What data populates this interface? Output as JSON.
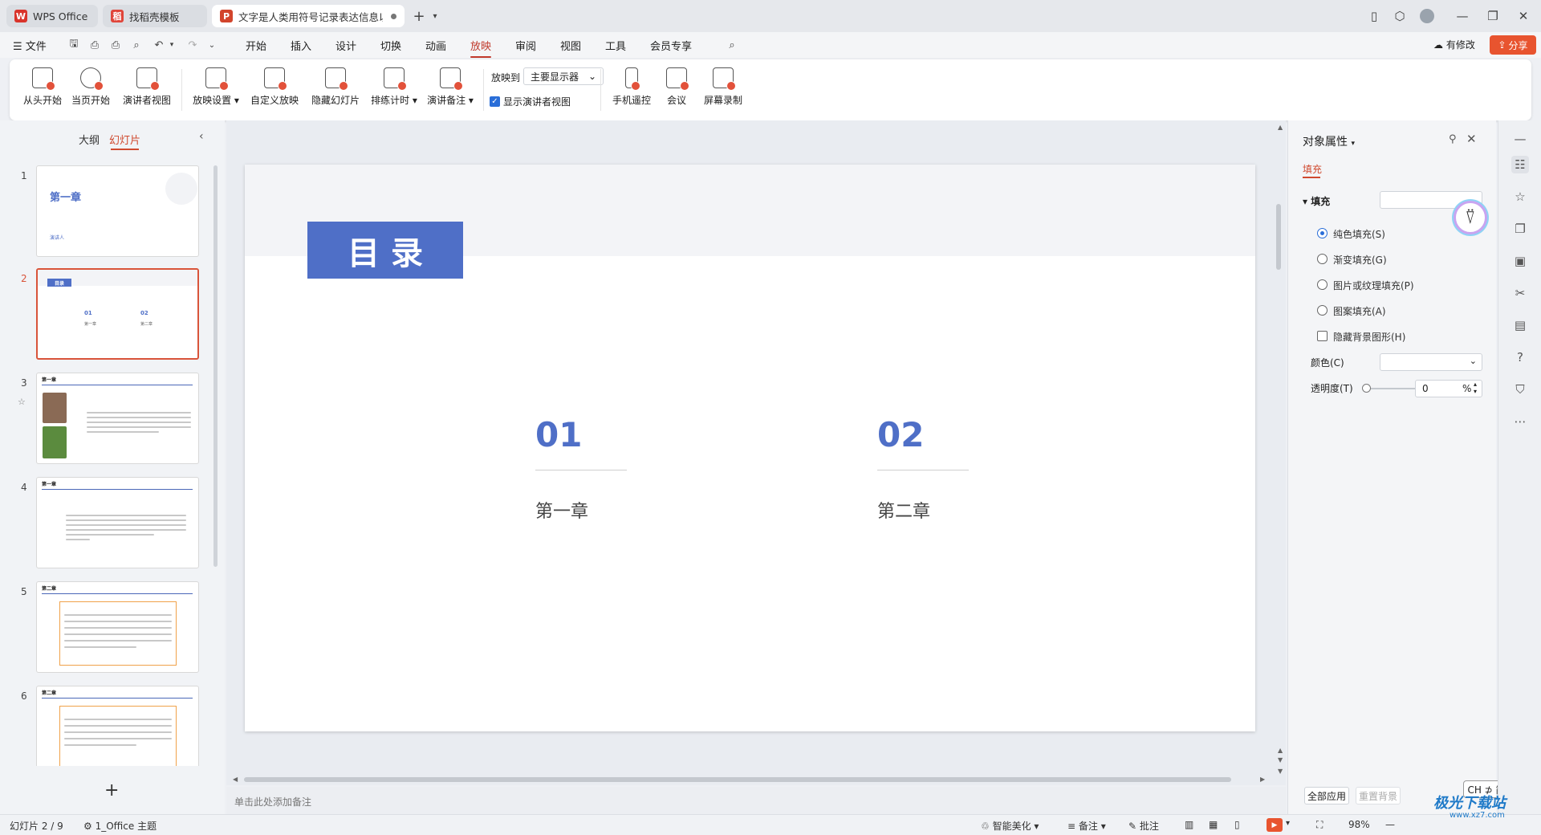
{
  "tabs": [
    {
      "label": "WPS Office"
    },
    {
      "label": "找稻壳模板"
    },
    {
      "label": "文字是人类用符号记录表达信息以"
    }
  ],
  "menu": {
    "file": "文件",
    "items": [
      "开始",
      "插入",
      "设计",
      "切换",
      "动画",
      "放映",
      "审阅",
      "视图",
      "工具",
      "会员专享"
    ],
    "active": "放映",
    "modify": "有修改",
    "share": "分享"
  },
  "ribbon": {
    "from_start": "从头开始",
    "from_current": "当页开始",
    "presenter_view": "演讲者视图",
    "slideshow_settings": "放映设置",
    "custom_show": "自定义放映",
    "hide_slide": "隐藏幻灯片",
    "rehearse": "排练计时",
    "speaker_notes": "演讲备注",
    "play_to_label": "放映到",
    "play_to_value": "主要显示器",
    "show_presenter_view": "显示演讲者视图",
    "phone_remote": "手机遥控",
    "meeting": "会议",
    "screen_record": "屏幕录制"
  },
  "left_panel": {
    "tab_outline": "大纲",
    "tab_slides": "幻灯片",
    "thumbs": [
      {
        "num": "1",
        "title": "第一章",
        "sub": "演讲人"
      },
      {
        "num": "2",
        "title": "目录",
        "n1": "01",
        "n2": "02",
        "c1": "第一章",
        "c2": "第二章"
      },
      {
        "num": "3",
        "title": "第一章"
      },
      {
        "num": "4",
        "title": "第一章"
      },
      {
        "num": "5",
        "title": "第二章"
      },
      {
        "num": "6",
        "title": "第二章"
      }
    ],
    "add": "+"
  },
  "slide": {
    "title": "目 录",
    "items": [
      {
        "num": "01",
        "label": "第一章"
      },
      {
        "num": "02",
        "label": "第二章"
      }
    ]
  },
  "notes_placeholder": "单击此处添加备注",
  "right_panel": {
    "title": "对象属性",
    "tab": "填充",
    "section": "填充",
    "options": [
      "纯色填充(S)",
      "渐变填充(G)",
      "图片或纹理填充(P)",
      "图案填充(A)"
    ],
    "hide_bg": "隐藏背景图形(H)",
    "color_label": "颜色(C)",
    "transparency_label": "透明度(T)",
    "transparency_value": "0",
    "percent": "%",
    "apply_all": "全部应用",
    "reset_bg": "重置背景"
  },
  "ime": "CH ⊅ 简",
  "status": {
    "slide_info": "幻灯片 2 / 9",
    "theme": "1_Office 主题",
    "smart": "智能美化",
    "notes": "备注",
    "comments": "批注",
    "zoom": "98%"
  },
  "watermark": "极光下载站",
  "watermark_url": "www.xz7.com",
  "colors": {
    "accent": "#c0392b",
    "share": "#e8542f",
    "slide_blue": "#4f6fc7",
    "selected_border": "#d9543a"
  }
}
